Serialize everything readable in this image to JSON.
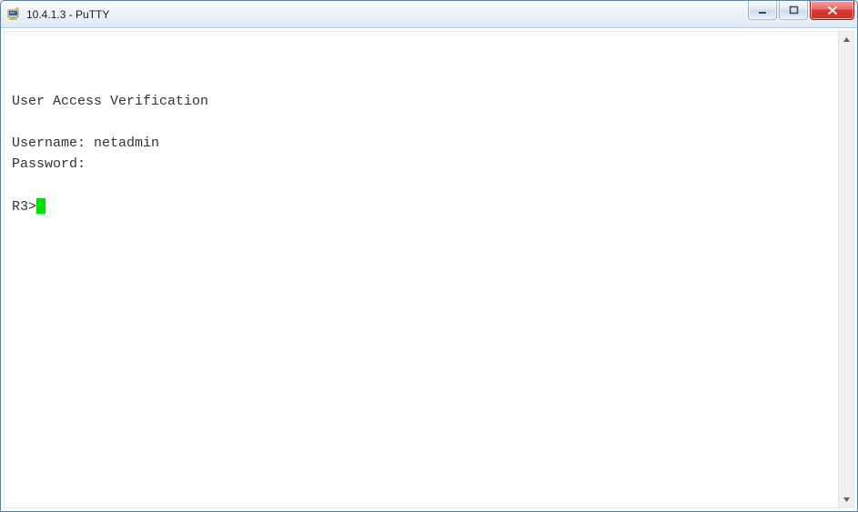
{
  "window": {
    "title": "10.4.1.3 - PuTTY"
  },
  "terminal": {
    "blank_line": "",
    "header": "User Access Verification",
    "username_label": "Username: ",
    "username_value": "netadmin",
    "password_label": "Password:",
    "prompt": "R3>"
  }
}
